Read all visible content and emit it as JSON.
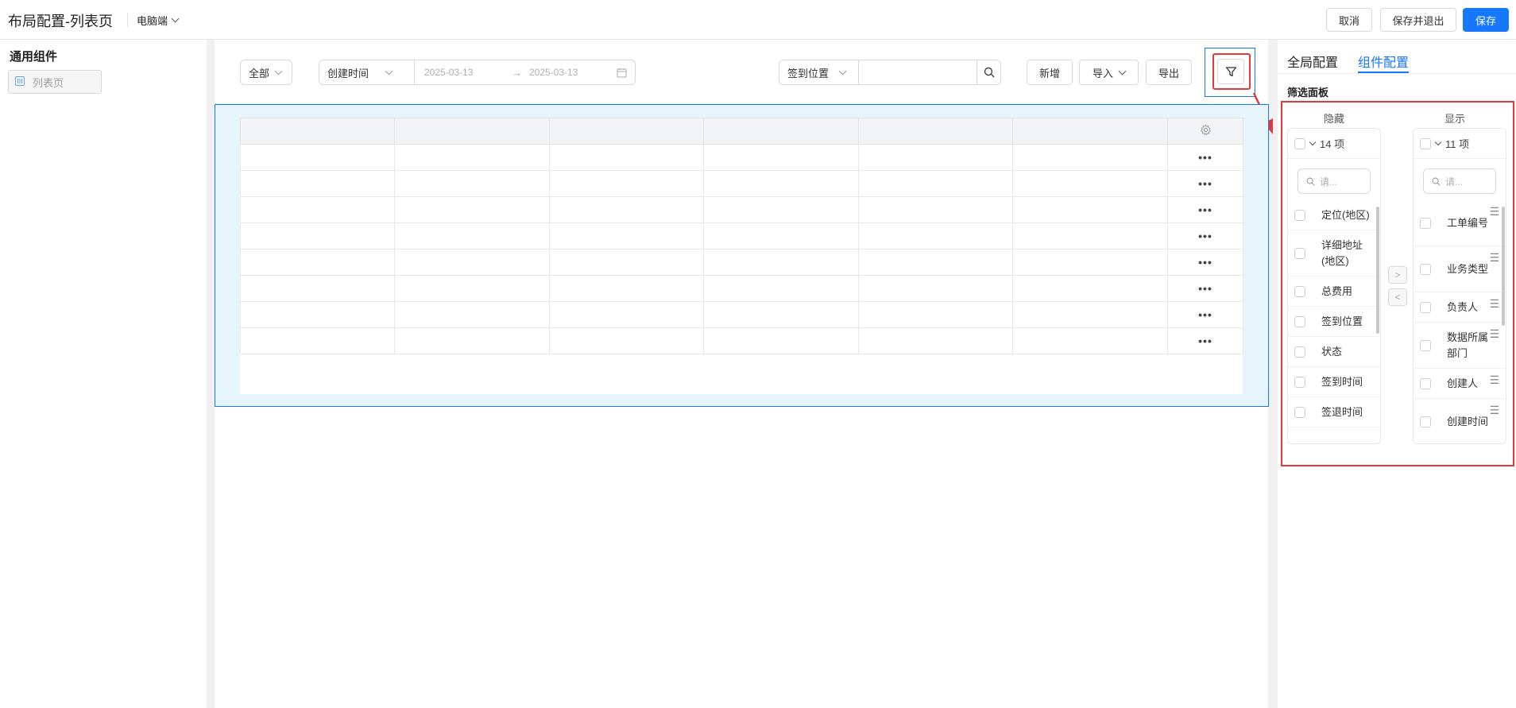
{
  "header": {
    "title": "布局配置-列表页",
    "device": "电脑端",
    "cancel_label": "取消",
    "save_exit_label": "保存并退出",
    "save_label": "保存"
  },
  "left_panel": {
    "title": "通用组件",
    "items": [
      {
        "label": "列表页",
        "icon": "list-page-icon"
      }
    ]
  },
  "toolbar": {
    "scope_select": "全部",
    "date_field_select": "创建时间",
    "date_start": "2025-03-13",
    "date_end": "2025-03-13",
    "search_field_select": "签到位置",
    "search_value": "",
    "add_label": "新增",
    "import_label": "导入",
    "export_label": "导出"
  },
  "table": {
    "columns": [
      "",
      "",
      "",
      "",
      "",
      ""
    ],
    "row_count": 8,
    "row_action": "•••"
  },
  "right_panel": {
    "tabs": [
      {
        "label": "全局配置",
        "active": false
      },
      {
        "label": "组件配置",
        "active": true
      }
    ],
    "section_label": "筛选面板",
    "transfer": {
      "left": {
        "title": "隐藏",
        "count_label": "14 项",
        "search_placeholder": "请...",
        "items": [
          "定位(地区)",
          "详细地址(地区)",
          "总费用",
          "签到位置",
          "状态",
          "签到时间",
          "签退时间"
        ]
      },
      "right": {
        "title": "显示",
        "count_label": "11 项",
        "search_placeholder": "请...",
        "items": [
          "工单编号",
          "业务类型",
          "负责人",
          "数据所属部门",
          "创建人",
          "创建时间"
        ]
      },
      "to_right": ">",
      "to_left": "<"
    }
  },
  "colors": {
    "primary": "#1677ff",
    "highlight_red": "#e53935",
    "selection_bg": "#e6f4fb"
  }
}
